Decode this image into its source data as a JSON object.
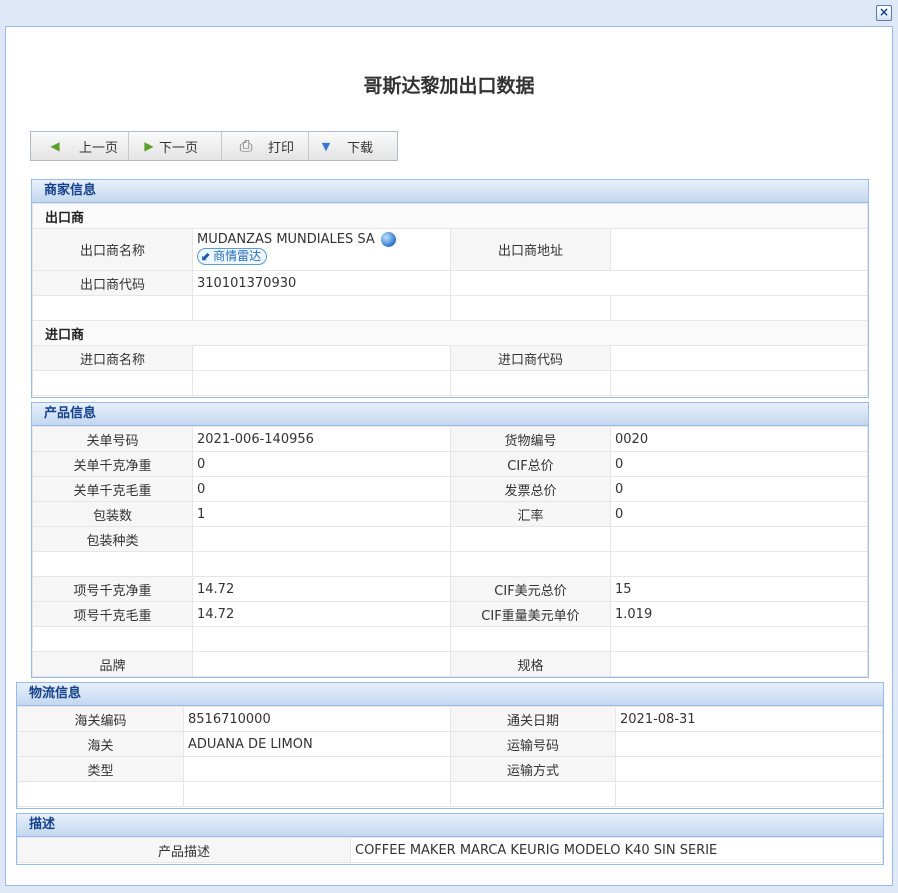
{
  "page": {
    "title": "哥斯达黎加出口数据",
    "close_label": "×"
  },
  "toolbar": {
    "prev": "上一页",
    "next": "下一页",
    "print": "打印",
    "download": "下载"
  },
  "merchant": {
    "header": "商家信息",
    "exporter_section": "出口商",
    "exporter_name_label": "出口商名称",
    "exporter_name": "MUDANZAS MUNDIALES SA",
    "radar_label": "商情雷达",
    "exporter_address_label": "出口商地址",
    "exporter_address": "",
    "exporter_code_label": "出口商代码",
    "exporter_code": "310101370930",
    "importer_section": "进口商",
    "importer_name_label": "进口商名称",
    "importer_name": "",
    "importer_code_label": "进口商代码",
    "importer_code": ""
  },
  "product": {
    "header": "产品信息",
    "declaration_no_label": "关单号码",
    "declaration_no": "2021-006-140956",
    "item_no_label": "货物编号",
    "item_no": "0020",
    "decl_net_kg_label": "关单千克净重",
    "decl_net_kg": "0",
    "cif_total_label": "CIF总价",
    "cif_total": "0",
    "decl_gross_kg_label": "关单千克毛重",
    "decl_gross_kg": "0",
    "invoice_total_label": "发票总价",
    "invoice_total": "0",
    "packages_label": "包装数",
    "packages": "1",
    "exchange_rate_label": "汇率",
    "exchange_rate": "0",
    "package_type_label": "包装种类",
    "package_type": "",
    "item_net_kg_label": "项号千克净重",
    "item_net_kg": "14.72",
    "cif_usd_total_label": "CIF美元总价",
    "cif_usd_total": "15",
    "item_gross_kg_label": "项号千克毛重",
    "item_gross_kg": "14.72",
    "cif_weight_usd_unit_label": "CIF重量美元单价",
    "cif_weight_usd_unit": "1.019",
    "brand_label": "品牌",
    "brand": "",
    "spec_label": "规格",
    "spec": ""
  },
  "logistics": {
    "header": "物流信息",
    "hs_code_label": "海关编码",
    "hs_code": "8516710000",
    "clearance_date_label": "通关日期",
    "clearance_date": "2021-08-31",
    "customs_label": "海关",
    "customs": "ADUANA DE LIMON",
    "transport_no_label": "运输号码",
    "transport_no": "",
    "type_label": "类型",
    "type": "",
    "transport_mode_label": "运输方式",
    "transport_mode": ""
  },
  "description": {
    "header": "描述",
    "product_desc_label": "产品描述",
    "product_desc": "COFFEE MAKER MARCA KEURIG MODELO K40 SIN SERIE"
  }
}
